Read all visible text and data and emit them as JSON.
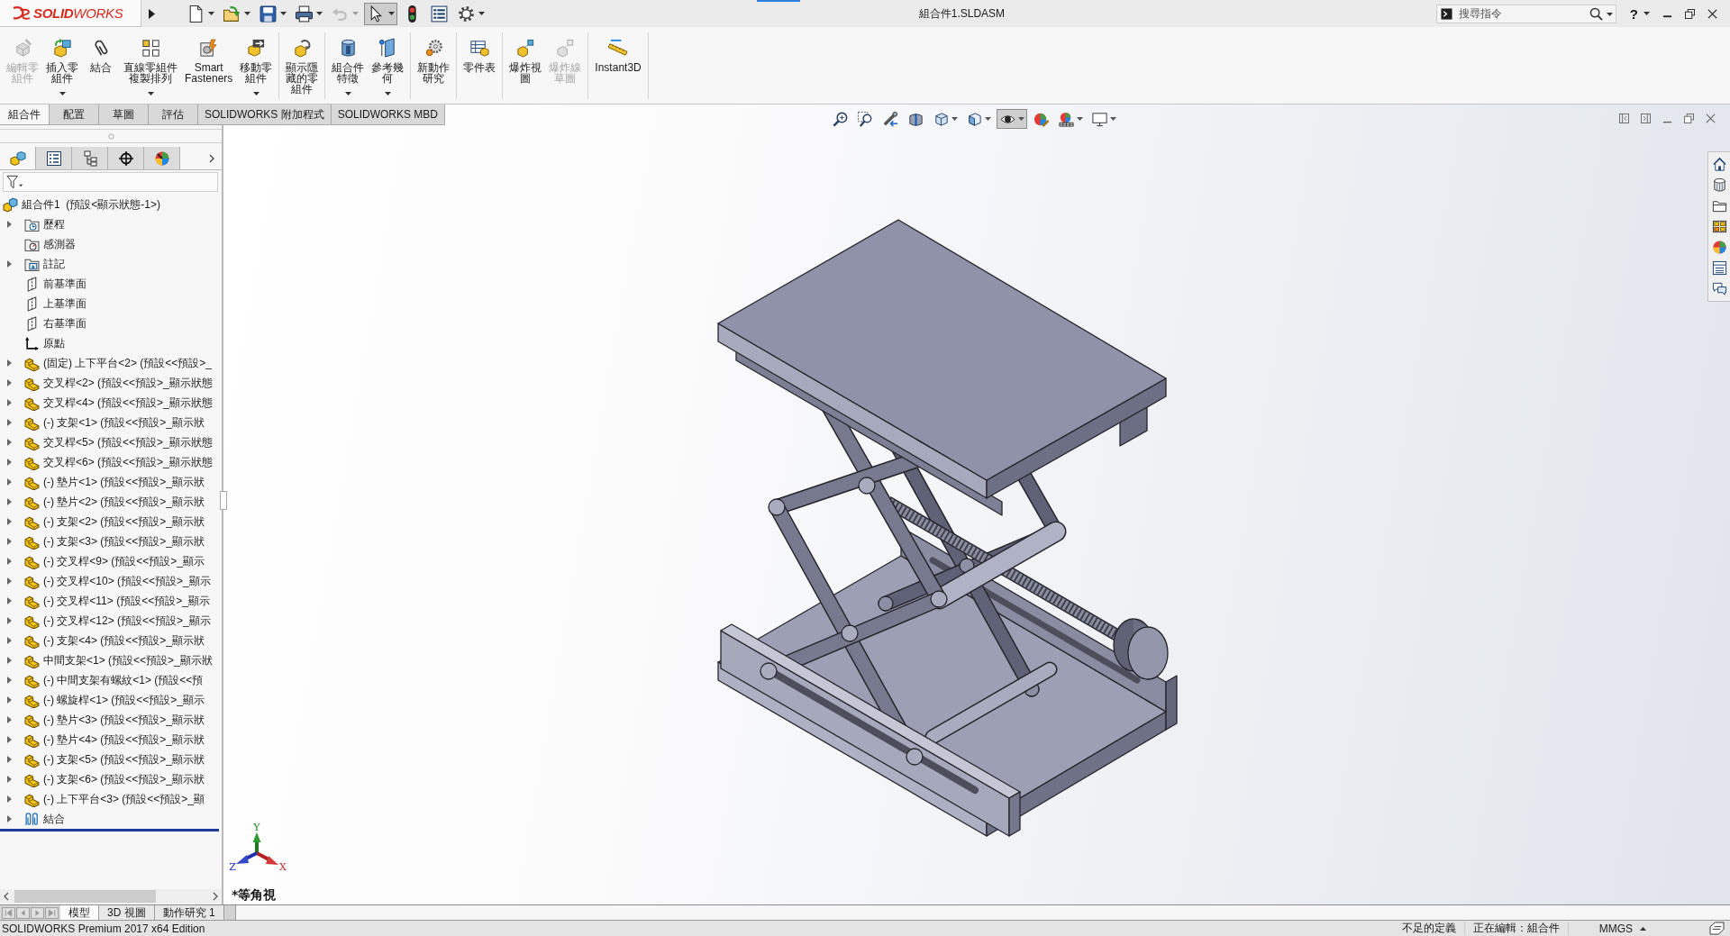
{
  "title_bar": {
    "logo": "**SOLID**WORKS",
    "quick_access": [
      {
        "kind": "new",
        "caret": true,
        "disabled": false,
        "active": false
      },
      {
        "kind": "open",
        "caret": true,
        "disabled": false,
        "active": false
      },
      {
        "kind": "save",
        "caret": true,
        "disabled": false,
        "active": false
      },
      {
        "kind": "print",
        "caret": true,
        "disabled": false,
        "active": false
      },
      {
        "kind": "undo",
        "caret": true,
        "disabled": true,
        "active": false
      },
      {
        "kind": "select",
        "caret": true,
        "disabled": false,
        "active": true
      },
      {
        "kind": "rebuild",
        "caret": false,
        "disabled": false,
        "active": false
      },
      {
        "kind": "file_properties",
        "caret": false,
        "disabled": false,
        "active": false
      },
      {
        "kind": "options",
        "caret": true,
        "disabled": false,
        "active": false
      }
    ],
    "document_title": "組合件1.SLDASM",
    "search": {
      "placeholder": "搜尋指令"
    },
    "help": "?"
  },
  "ribbon": {
    "groups": [
      {
        "commands": [
          {
            "kind": "edit_component",
            "lines": [
              "編輯零",
              "組件"
            ],
            "disabled": true,
            "dropdown": false
          },
          {
            "kind": "insert_components",
            "lines": [
              "插入零",
              "組件"
            ],
            "disabled": false,
            "dropdown": true
          },
          {
            "kind": "mate",
            "lines": [
              "結合"
            ],
            "disabled": false,
            "dropdown": false
          },
          {
            "kind": "linear_pattern",
            "lines": [
              "直線零組件",
              "複製排列"
            ],
            "disabled": false,
            "dropdown": true
          },
          {
            "kind": "smart_fasteners",
            "lines": [
              "Smart",
              "Fasteners"
            ],
            "disabled": false,
            "dropdown": false
          },
          {
            "kind": "move_component",
            "lines": [
              "移動零",
              "組件"
            ],
            "disabled": false,
            "dropdown": true
          }
        ]
      },
      {
        "commands": [
          {
            "kind": "show_hidden",
            "lines": [
              "顯示隱",
              "藏的零",
              "組件"
            ],
            "disabled": false,
            "dropdown": false
          }
        ]
      },
      {
        "commands": [
          {
            "kind": "assembly_features",
            "lines": [
              "組合件",
              "特徵"
            ],
            "disabled": false,
            "dropdown": true
          },
          {
            "kind": "reference_geometry",
            "lines": [
              "參考幾",
              "何"
            ],
            "disabled": false,
            "dropdown": true
          }
        ]
      },
      {
        "commands": [
          {
            "kind": "motion_study",
            "lines": [
              "新動作",
              "研究"
            ],
            "disabled": false,
            "dropdown": false
          }
        ]
      },
      {
        "commands": [
          {
            "kind": "bom",
            "lines": [
              "零件表"
            ],
            "disabled": false,
            "dropdown": false
          }
        ]
      },
      {
        "commands": [
          {
            "kind": "exploded_view",
            "lines": [
              "爆炸視",
              "圖"
            ],
            "disabled": false,
            "dropdown": false
          },
          {
            "kind": "explode_line_sketch",
            "lines": [
              "爆炸線",
              "草圖"
            ],
            "disabled": true,
            "dropdown": false
          }
        ]
      },
      {
        "commands": [
          {
            "kind": "instant3d",
            "lines": [
              "Instant3D"
            ],
            "disabled": false,
            "dropdown": false
          }
        ]
      }
    ]
  },
  "command_tabs": [
    {
      "label": "組合件",
      "selected": true
    },
    {
      "label": "配置",
      "selected": false
    },
    {
      "label": "草圖",
      "selected": false
    },
    {
      "label": "評估",
      "selected": false
    },
    {
      "label": "SOLIDWORKS 附加程式",
      "selected": false
    },
    {
      "label": "SOLIDWORKS MBD",
      "selected": false
    }
  ],
  "feature_manager": {
    "tabs": [
      {
        "kind": "feature_tree",
        "selected": true
      },
      {
        "kind": "property",
        "selected": false
      },
      {
        "kind": "configuration",
        "selected": false
      },
      {
        "kind": "dimxpert",
        "selected": false
      },
      {
        "kind": "display",
        "selected": false
      }
    ],
    "tree": {
      "label": "組合件1  (預設<顯示狀態-1>)",
      "children": [
        {
          "kind": "history",
          "label": "歷程",
          "expandable": true
        },
        {
          "kind": "sensors",
          "label": "感測器",
          "expandable": false
        },
        {
          "kind": "annotations",
          "label": "註記",
          "expandable": true
        },
        {
          "kind": "plane",
          "label": "前基準面",
          "expandable": false
        },
        {
          "kind": "plane",
          "label": "上基準面",
          "expandable": false
        },
        {
          "kind": "plane",
          "label": "右基準面",
          "expandable": false
        },
        {
          "kind": "origin",
          "label": "原點",
          "expandable": false
        },
        {
          "kind": "component",
          "label": "(固定) 上下平台<2> (預設<<預設>_",
          "expandable": true
        },
        {
          "kind": "component",
          "label": "交叉桿<2> (預設<<預設>_顯示狀態",
          "expandable": true
        },
        {
          "kind": "component",
          "label": "交叉桿<4> (預設<<預設>_顯示狀態",
          "expandable": true
        },
        {
          "kind": "component",
          "label": "(-) 支架<1> (預設<<預設>_顯示狀",
          "expandable": true
        },
        {
          "kind": "component",
          "label": "交叉桿<5> (預設<<預設>_顯示狀態",
          "expandable": true
        },
        {
          "kind": "component",
          "label": "交叉桿<6> (預設<<預設>_顯示狀態",
          "expandable": true
        },
        {
          "kind": "component",
          "label": "(-) 墊片<1> (預設<<預設>_顯示狀",
          "expandable": true
        },
        {
          "kind": "component",
          "label": "(-) 墊片<2> (預設<<預設>_顯示狀",
          "expandable": true
        },
        {
          "kind": "component",
          "label": "(-) 支架<2> (預設<<預設>_顯示狀",
          "expandable": true
        },
        {
          "kind": "component",
          "label": "(-) 支架<3> (預設<<預設>_顯示狀",
          "expandable": true
        },
        {
          "kind": "component",
          "label": "(-) 交叉桿<9> (預設<<預設>_顯示",
          "expandable": true
        },
        {
          "kind": "component",
          "label": "(-) 交叉桿<10> (預設<<預設>_顯示",
          "expandable": true
        },
        {
          "kind": "component",
          "label": "(-) 交叉桿<11> (預設<<預設>_顯示",
          "expandable": true
        },
        {
          "kind": "component",
          "label": "(-) 交叉桿<12> (預設<<預設>_顯示",
          "expandable": true
        },
        {
          "kind": "component",
          "label": "(-) 支架<4> (預設<<預設>_顯示狀",
          "expandable": true
        },
        {
          "kind": "component",
          "label": "中間支架<1> (預設<<預設>_顯示狀",
          "expandable": true
        },
        {
          "kind": "component",
          "label": "(-) 中間支架有螺紋<1> (預設<<預",
          "expandable": true
        },
        {
          "kind": "component",
          "label": "(-) 螺旋桿<1> (預設<<預設>_顯示",
          "expandable": true
        },
        {
          "kind": "component",
          "label": "(-) 墊片<3> (預設<<預設>_顯示狀",
          "expandable": true
        },
        {
          "kind": "component",
          "label": "(-) 墊片<4> (預設<<預設>_顯示狀",
          "expandable": true
        },
        {
          "kind": "component",
          "label": "(-) 支架<5> (預設<<預設>_顯示狀",
          "expandable": true
        },
        {
          "kind": "component",
          "label": "(-) 支架<6> (預設<<預設>_顯示狀",
          "expandable": true
        },
        {
          "kind": "component",
          "label": "(-) 上下平台<3> (預設<<預設>_顯",
          "expandable": true
        },
        {
          "kind": "mates",
          "label": "結合",
          "expandable": true
        }
      ]
    }
  },
  "viewport": {
    "view_toolbar": [
      {
        "kind": "zoom_fit",
        "caret": false,
        "active": false
      },
      {
        "kind": "zoom_area",
        "caret": false,
        "active": false
      },
      {
        "kind": "previous_view",
        "caret": false,
        "active": false
      },
      {
        "kind": "section_view",
        "caret": false,
        "active": false
      },
      {
        "kind": "view_orientation",
        "caret": true,
        "active": false
      },
      {
        "kind": "display_style",
        "caret": true,
        "active": false
      },
      {
        "kind": "hide_show",
        "caret": true,
        "active": true
      },
      {
        "kind": "edit_appearance",
        "caret": false,
        "active": false
      },
      {
        "kind": "apply_scene",
        "caret": true,
        "active": false
      },
      {
        "kind": "view_settings",
        "caret": true,
        "active": false
      }
    ],
    "triad": {
      "x": "X",
      "y": "Y",
      "z": "Z"
    },
    "view_name": "*等角視"
  },
  "bottom_tabs": [
    {
      "label": "模型",
      "selected": true
    },
    {
      "label": "3D 視圖",
      "selected": false
    },
    {
      "label": "動作研究 1",
      "selected": false
    }
  ],
  "status_bar": {
    "product": "SOLIDWORKS Premium 2017 x64 Edition",
    "definition": "不足的定義",
    "editing": "正在編輯：組合件",
    "units": "MMGS"
  }
}
